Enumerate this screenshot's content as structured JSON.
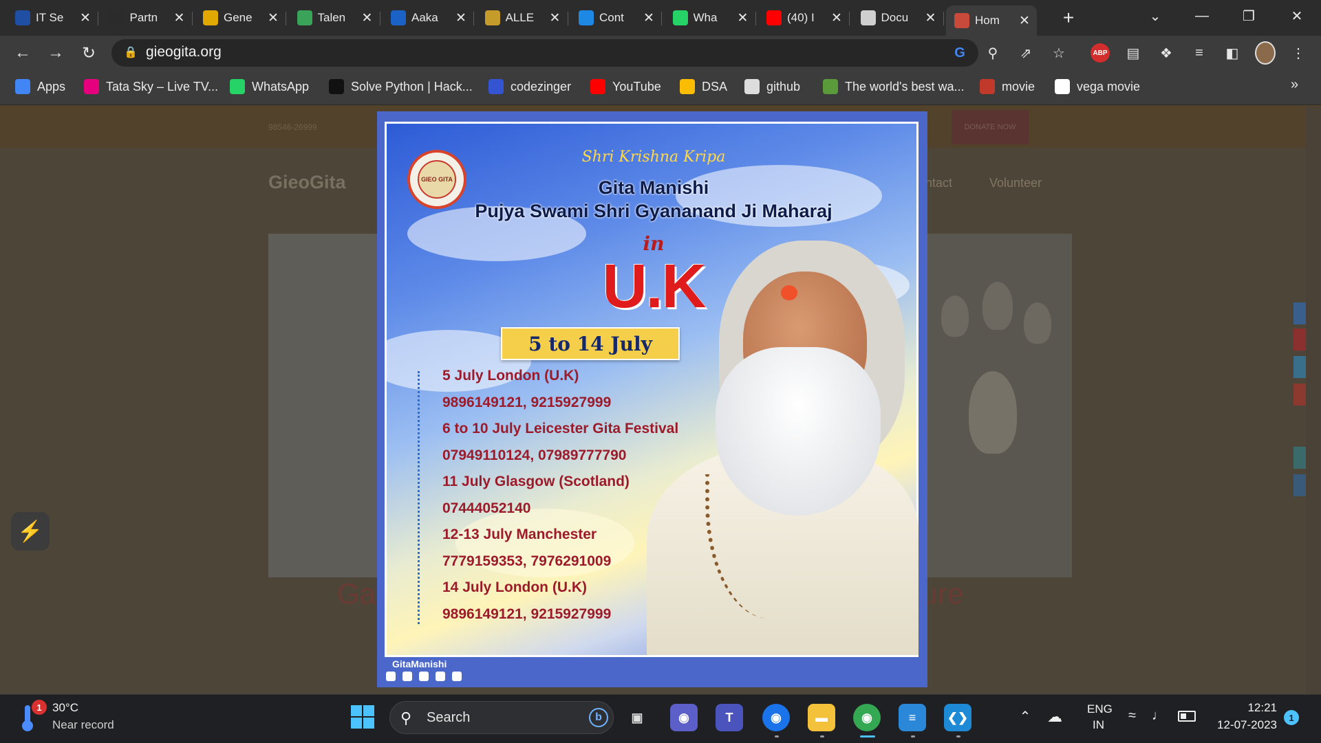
{
  "browser": {
    "tabs": [
      {
        "label": "IT Se",
        "icon": "bigrock-icon",
        "color": "#1f4fa3"
      },
      {
        "label": "Partn",
        "icon": "partner-icon",
        "color": "#2b2b2b"
      },
      {
        "label": "Gene",
        "icon": "generic-icon",
        "color": "#e0a800"
      },
      {
        "label": "Talen",
        "icon": "talent-icon",
        "color": "#3aa35a"
      },
      {
        "label": "Aaka",
        "icon": "aakash-icon",
        "color": "#1a62c6"
      },
      {
        "label": "ALLE",
        "icon": "allen-icon",
        "color": "#c59b2a"
      },
      {
        "label": "Cont",
        "icon": "contest-icon",
        "color": "#1e88e5"
      },
      {
        "label": "Wha",
        "icon": "whatsapp-icon",
        "color": "#25d366"
      },
      {
        "label": "(40) I",
        "icon": "youtube-icon",
        "color": "#ff0000"
      },
      {
        "label": "Docu",
        "icon": "globe-icon",
        "color": "#cfcfcf"
      },
      {
        "label": "Hom",
        "icon": "gieogita-icon",
        "color": "#c9493a",
        "active": true
      }
    ],
    "url": "gieogita.org",
    "bookmarks": [
      {
        "label": "Apps",
        "icon": "apps-grid-icon",
        "color": "#4285f4"
      },
      {
        "label": "Tata Sky – Live TV...",
        "icon": "tataplay-icon",
        "color": "#e6007e"
      },
      {
        "label": "WhatsApp",
        "icon": "whatsapp-icon",
        "color": "#25d366"
      },
      {
        "label": "Solve Python | Hack...",
        "icon": "hackerrank-icon",
        "color": "#111111"
      },
      {
        "label": "codezinger",
        "icon": "codezinger-icon",
        "color": "#3454d1"
      },
      {
        "label": "YouTube",
        "icon": "youtube-icon",
        "color": "#ff0000"
      },
      {
        "label": "DSA",
        "icon": "google-drive-icon",
        "color": "#fbbc04"
      },
      {
        "label": "github",
        "icon": "github-icon",
        "color": "#dddddd"
      },
      {
        "label": "The world's best wa...",
        "icon": "wallpaper-icon",
        "color": "#5a9a3a"
      },
      {
        "label": "movie",
        "icon": "movie-icon",
        "color": "#c0392b"
      },
      {
        "label": "vega movie",
        "icon": "google-icon",
        "color": "#ffffff"
      }
    ],
    "bookmarks_more": "»",
    "abp_label": "ABP"
  },
  "page": {
    "phone": "98546-26999",
    "donate_label": "DONATE NOW",
    "logo": "GieoGita",
    "nav_contact": "ntact",
    "nav_volunteer": "Volunteer",
    "hero_left_text": "Ga",
    "hero_right_text": "ture"
  },
  "poster": {
    "logo_text": "GIEO GITA",
    "kripa": "Shri Krishna Kripa",
    "title_line1": "Gita Manishi",
    "title_line2": "Pujya Swami Shri Gyananand Ji Maharaj",
    "in_word": "in",
    "country": "U.K",
    "date_range": "5 to 14 July",
    "schedule": [
      "5 July London (U.K)",
      "9896149121, 9215927999",
      "6 to 10 July Leicester Gita Festival",
      "07949110124, 07989777790",
      "11 July Glasgow (Scotland)",
      "07444052140",
      "12-13 July Manchester",
      "7779159353, 7976291009",
      "14 July London (U.K)",
      "9896149121, 9215927999"
    ],
    "footer_handle": "GitaManishi",
    "social_icons": [
      "instagram-icon",
      "facebook-icon",
      "twitter-icon",
      "youtube-icon",
      "whatsapp-icon"
    ]
  },
  "taskbar": {
    "weather_badge": "1",
    "temperature": "30°C",
    "weather_note": "Near record",
    "search_placeholder": "Search",
    "apps": [
      "file-manager-icon",
      "meet-icon",
      "teams-icon",
      "chrome-profile-icon",
      "file-explorer-icon",
      "chrome-icon",
      "notepad-icon",
      "vscode-icon"
    ],
    "lang_line1": "ENG",
    "lang_line2": "IN",
    "time": "12:21",
    "date": "12-07-2023",
    "notifications": "1"
  }
}
